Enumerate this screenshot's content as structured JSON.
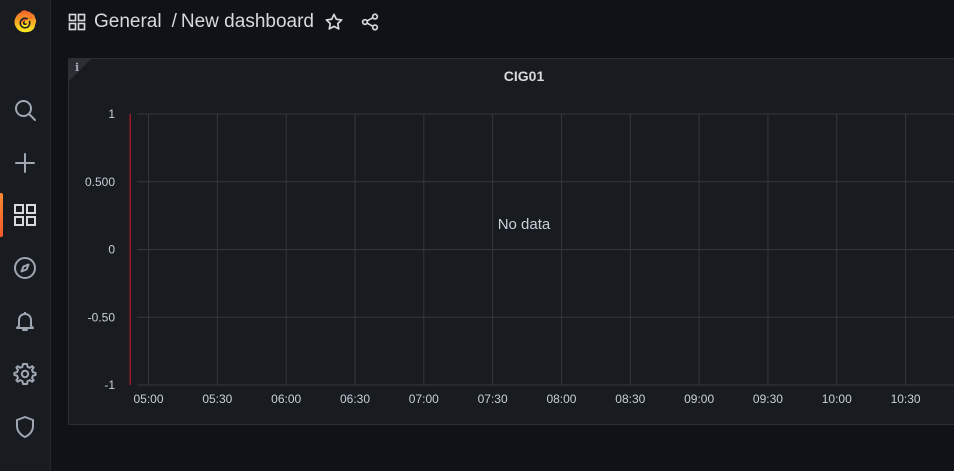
{
  "sidebar": {
    "logo": "grafana-logo",
    "items": [
      {
        "name": "search",
        "icon": "search-icon",
        "active": false
      },
      {
        "name": "create",
        "icon": "plus-icon",
        "active": false
      },
      {
        "name": "dashboards",
        "icon": "dashboards-grid-icon",
        "active": true
      },
      {
        "name": "explore",
        "icon": "compass-icon",
        "active": false
      },
      {
        "name": "alerting",
        "icon": "bell-icon",
        "active": false
      },
      {
        "name": "configuration",
        "icon": "gear-icon",
        "active": false
      },
      {
        "name": "server-admin",
        "icon": "shield-icon",
        "active": false
      }
    ]
  },
  "header": {
    "folder": "General",
    "separator": "/",
    "dashboard_title": "New dashboard",
    "icons": [
      "dashboards-grid-icon",
      "star-icon",
      "share-icon"
    ]
  },
  "panel": {
    "title": "CIG01",
    "info_label": "i",
    "no_data_text": "No data"
  },
  "colors": {
    "accent": "#f05a28",
    "background": "#111217",
    "panel": "#181b1f",
    "grid": "#34373d",
    "marker": "#c4162a"
  },
  "chart_data": {
    "type": "line",
    "title": "CIG01",
    "series": [],
    "y_ticks": [
      "1",
      "0.500",
      "0",
      "-0.50",
      "-1"
    ],
    "y_values": [
      1,
      0.5,
      0,
      -0.5,
      -1
    ],
    "ylim": [
      -1,
      1
    ],
    "x_ticks": [
      "05:00",
      "05:30",
      "06:00",
      "06:30",
      "07:00",
      "07:30",
      "08:00",
      "08:30",
      "09:00",
      "09:30",
      "10:00",
      "10:30"
    ],
    "x_range": [
      "04:48",
      "10:42"
    ],
    "annotation_time": "04:52",
    "grid": true,
    "message": "No data"
  }
}
